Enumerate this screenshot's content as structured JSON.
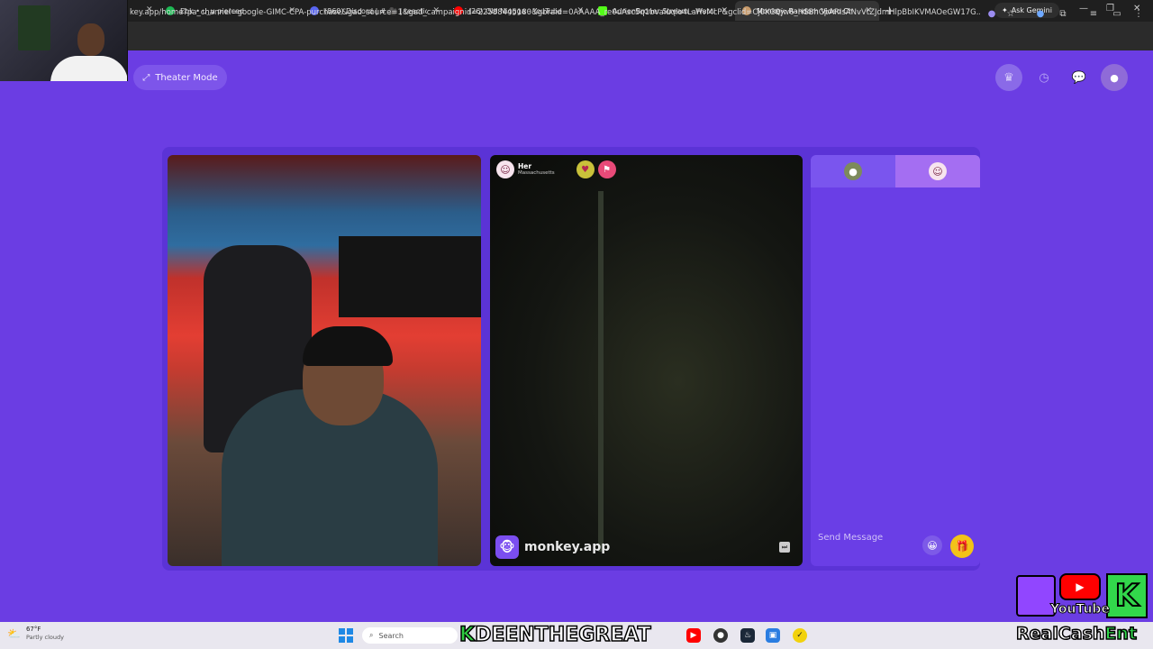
{
  "browser": {
    "tabs": [
      {
        "title": "Ebk • u_u pierced",
        "favicon_color": "#1db954"
      },
      {
        "title": "(860) Discord | # 🎥 | reactions",
        "favicon_color": "#5865f2"
      },
      {
        "title": "(26) Old Niggga - YouTube",
        "favicon_color": "#ff0000"
      },
      {
        "title": "AdrienBroner Stream - Watch L",
        "favicon_color": "#53fc18"
      },
      {
        "title": "Monkey: Random Video Ch",
        "favicon_color": "#c89a6a"
      }
    ],
    "new_tab": "+",
    "ask_gemini": "Ask Gemini",
    "url": "key.app/home?pa_channel=google-GIMC-CPA-purchase&gad_source=1&gad_campaignid=22588445180&gbraid=0AAAAA_re0uAsc5q1bvaluqlo4LaHvMcP&gclid=Cj0KCQjw6_HSBhCpARIsANvVtZJdmHlpBbIKVMAOeGW17G..."
  },
  "page": {
    "theater_mode": "Theater Mode",
    "peer": {
      "name": "Her",
      "location": "Massachusetts"
    },
    "brand": "monkey.app",
    "chat": {
      "send_placeholder": "Send Message"
    }
  },
  "taskbar": {
    "temperature": "67°F",
    "condition": "Partly cloudy",
    "search": "Search"
  },
  "overlay": {
    "streamer_k": "K",
    "streamer_rest": "DEENTHEGREAT",
    "youtube_word": "YouTube",
    "brand_main": "RealCash",
    "brand_tail": "Ent",
    "big_k": "K"
  },
  "colors": {
    "page_bg": "#6b3de3",
    "accent": "#7b4ef0",
    "gift": "#f2c318"
  }
}
